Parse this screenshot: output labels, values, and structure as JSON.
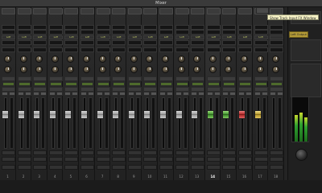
{
  "window": {
    "title": "Mixer"
  },
  "tooltip": "Show Track Input FX Window",
  "output_button_label": "Left Output",
  "channels": [
    {
      "number": "1",
      "label": "Lofi",
      "fader_color": "gray"
    },
    {
      "number": "2",
      "label": "Lofi",
      "fader_color": "gray"
    },
    {
      "number": "3",
      "label": "Lofi",
      "fader_color": "gray"
    },
    {
      "number": "4",
      "label": "Lofi",
      "fader_color": "gray"
    },
    {
      "number": "5",
      "label": "Lofi",
      "fader_color": "gray"
    },
    {
      "number": "6",
      "label": "Lofi",
      "fader_color": "gray"
    },
    {
      "number": "7",
      "label": "Lofi",
      "fader_color": "gray"
    },
    {
      "number": "8",
      "label": "Lofi",
      "fader_color": "gray"
    },
    {
      "number": "9",
      "label": "Lofi",
      "fader_color": "gray"
    },
    {
      "number": "10",
      "label": "Lofi",
      "fader_color": "gray"
    },
    {
      "number": "11",
      "label": "Lofi",
      "fader_color": "gray"
    },
    {
      "number": "12",
      "label": "Lofi",
      "fader_color": "gray"
    },
    {
      "number": "13",
      "label": "Lofi",
      "fader_color": "gray"
    },
    {
      "number": "14",
      "label": "Lofi",
      "fader_color": "green",
      "selected": true
    },
    {
      "number": "15",
      "label": "Lofi",
      "fader_color": "green"
    },
    {
      "number": "16",
      "label": "Lofi",
      "fader_color": "red"
    },
    {
      "number": "17",
      "label": "Lofi",
      "fader_color": "yellow"
    },
    {
      "number": "18",
      "label": "",
      "fader_color": "none"
    }
  ]
}
